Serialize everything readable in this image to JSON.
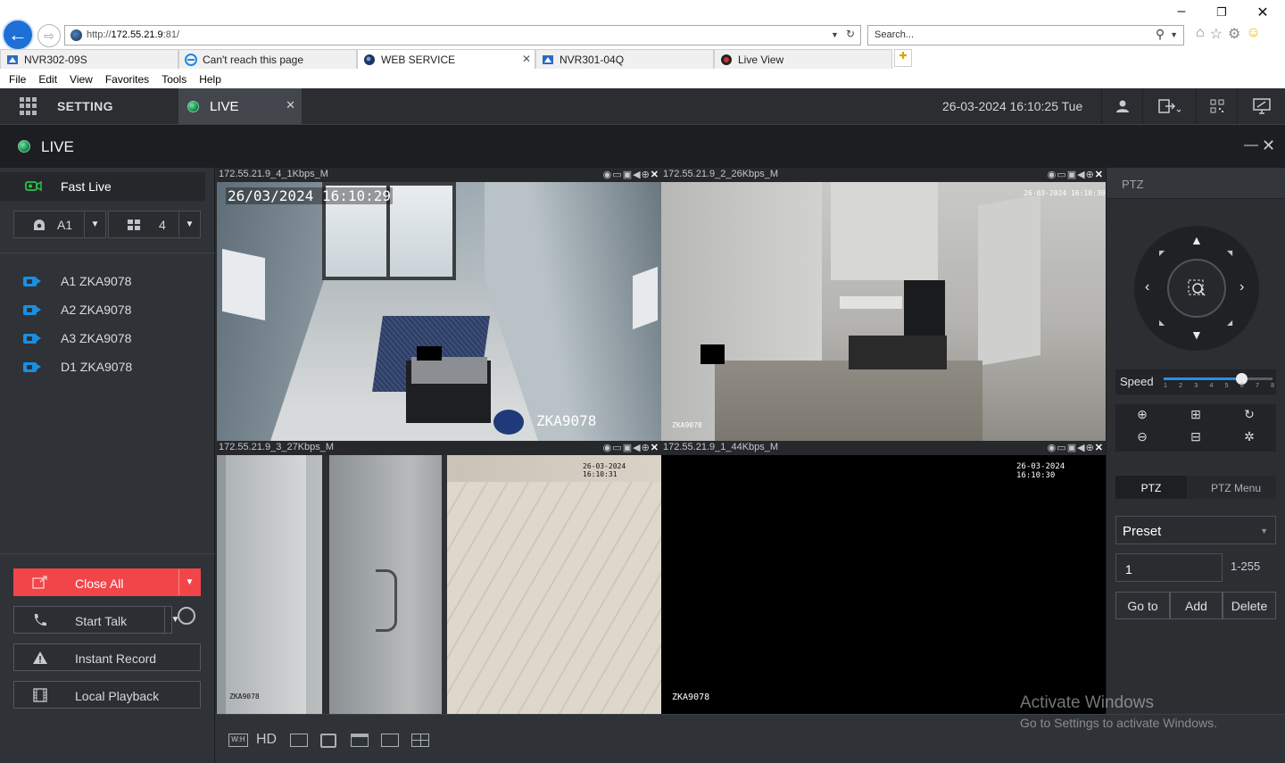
{
  "browser": {
    "address_prefix": "http://",
    "address_host": "172.55.21.9",
    "address_suffix": ":81/",
    "search_placeholder": "Search...",
    "tabs": [
      {
        "label": "NVR302-09S"
      },
      {
        "label": "Can't reach this page"
      },
      {
        "label": "WEB SERVICE"
      },
      {
        "label": "NVR301-04Q"
      },
      {
        "label": "Live View"
      }
    ],
    "menu": [
      "File",
      "Edit",
      "View",
      "Favorites",
      "Tools",
      "Help"
    ]
  },
  "topbar": {
    "setting_label": "SETTING",
    "live_label": "LIVE",
    "datetime": "26-03-2024 16:10:25 Tue"
  },
  "live_header": {
    "title": "LIVE"
  },
  "left_panel": {
    "fast_live": "Fast Live",
    "channel_select": "A1",
    "layout_select": "4",
    "cameras": [
      {
        "label": "A1 ZKA9078"
      },
      {
        "label": "A2 ZKA9078"
      },
      {
        "label": "A3 ZKA9078"
      },
      {
        "label": "D1 ZKA9078"
      }
    ],
    "close_all": "Close All",
    "start_talk": "Start Talk",
    "instant_record": "Instant Record",
    "local_playback": "Local Playback"
  },
  "tiles": [
    {
      "title": "172.55.21.9_4_1Kbps_M",
      "timestamp": "26/03/2024 16:10:29",
      "name": "ZKA9078"
    },
    {
      "title": "172.55.21.9_2_26Kbps_M",
      "timestamp": "26-03-2024 16:10:30",
      "name": "ZKA9078"
    },
    {
      "title": "172.55.21.9_3_27Kbps_M",
      "timestamp": "26-03-2024 16:10:31",
      "name": "ZKA9078"
    },
    {
      "title": "172.55.21.9_1_44Kbps_M",
      "timestamp": "26-03-2024 16:10:30",
      "name": "ZKA9078"
    }
  ],
  "grid_toolbar": {
    "hd_label": "HD",
    "wh_label": "W:H"
  },
  "ptz": {
    "header": "PTZ",
    "speed_label": "Speed",
    "speed_value": 6,
    "speed_ticks": [
      "1",
      "2",
      "3",
      "4",
      "5",
      "6",
      "7",
      "8"
    ],
    "tab_ptz": "PTZ",
    "tab_menu": "PTZ Menu",
    "preset_type": "Preset",
    "preset_number": "1",
    "preset_range": "1-255",
    "goto": "Go to",
    "add": "Add",
    "delete": "Delete"
  },
  "watermark": {
    "title": "Activate Windows",
    "subtitle": "Go to Settings to activate Windows."
  }
}
